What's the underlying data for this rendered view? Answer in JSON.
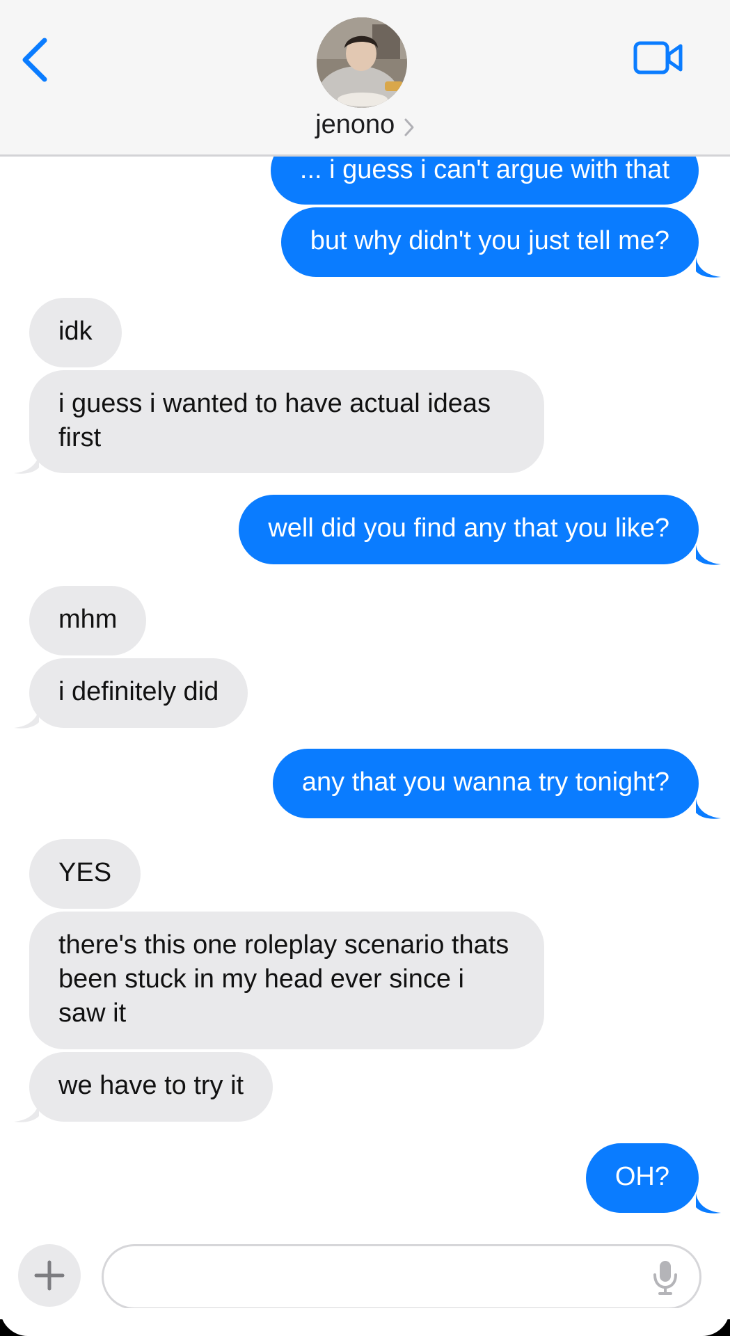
{
  "header": {
    "contact_name": "jenono",
    "back_icon": "chevron-left-icon",
    "video_icon": "video-camera-icon"
  },
  "messages": [
    {
      "from": "me",
      "text": "... i guess i can't argue with that"
    },
    {
      "from": "me",
      "text": "but why didn't you just tell me?"
    },
    {
      "from": "them",
      "text": "idk"
    },
    {
      "from": "them",
      "text": "i guess i wanted to have actual ideas first"
    },
    {
      "from": "me",
      "text": "well did you find any that you like?"
    },
    {
      "from": "them",
      "text": "mhm"
    },
    {
      "from": "them",
      "text": "i definitely did"
    },
    {
      "from": "me",
      "text": "any that you wanna try tonight?"
    },
    {
      "from": "them",
      "text": "YES"
    },
    {
      "from": "them",
      "text": "there's this one roleplay scenario thats been stuck in my head ever since i saw it"
    },
    {
      "from": "them",
      "text": "we have to try it"
    },
    {
      "from": "me",
      "text": "OH?"
    }
  ],
  "composer": {
    "value": "",
    "plus_icon": "plus-icon",
    "mic_icon": "microphone-icon"
  },
  "colors": {
    "sent_bubble": "#0a7cff",
    "received_bubble": "#e9e9eb",
    "accent": "#0a7cff",
    "header_bg": "#f6f6f6"
  }
}
